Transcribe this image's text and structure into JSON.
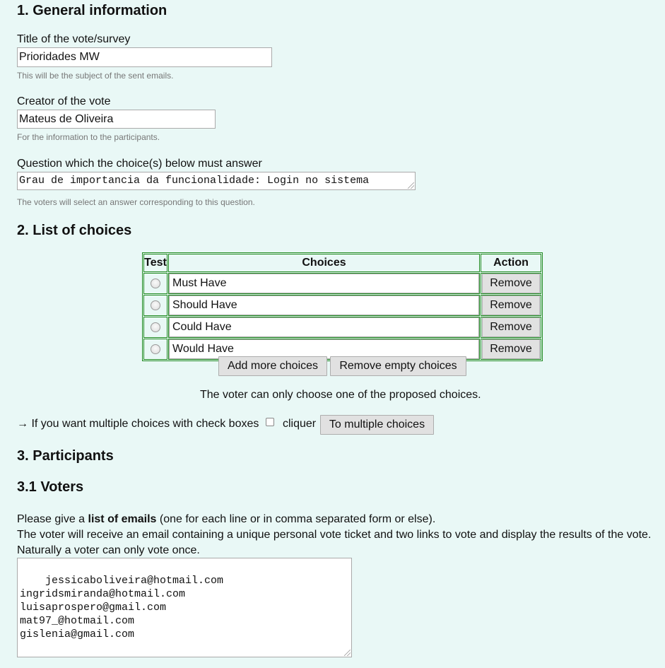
{
  "section1": {
    "heading": "1. General information",
    "title_label": "Title of the vote/survey",
    "title_value": "Prioridades MW",
    "title_hint": "This will be the subject of the sent emails.",
    "creator_label": "Creator of the vote",
    "creator_value": "Mateus de Oliveira",
    "creator_hint": "For the information to the participants.",
    "question_label": "Question which the choice(s) below must answer",
    "question_value": "Grau de importancia da funcionalidade: Login no sistema",
    "question_hint": "The voters will select an answer corresponding to this question."
  },
  "section2": {
    "heading": "2. List of choices",
    "columns": [
      "Test",
      "Choices",
      "Action"
    ],
    "choices": [
      "Must Have",
      "Should Have",
      "Could Have",
      "Would Have"
    ],
    "remove_label": "Remove",
    "add_more_label": "Add more choices",
    "remove_empty_label": "Remove empty choices",
    "single_note": "The voter can only choose one of the proposed choices.",
    "multi_prefix": "→ If you want multiple choices with check boxes",
    "multi_cliquer": "cliquer",
    "multi_button": "To multiple choices"
  },
  "section3": {
    "heading": "3. Participants",
    "sub_heading": "3.1 Voters",
    "intro_before": "Please give a ",
    "intro_bold": "list of emails",
    "intro_after": " (one for each line or in comma separated form or else).",
    "line2": "The voter will receive an email containing a unique personal vote ticket and two links to vote and display the results of the vote.",
    "line3": "Naturally a voter can only vote once.",
    "emails": "jessicaboliveira@hotmail.com\ningridsmiranda@hotmail.com\nluisaprospero@gmail.com\nmat97_@hotmail.com\ngislenia@gmail.com"
  }
}
